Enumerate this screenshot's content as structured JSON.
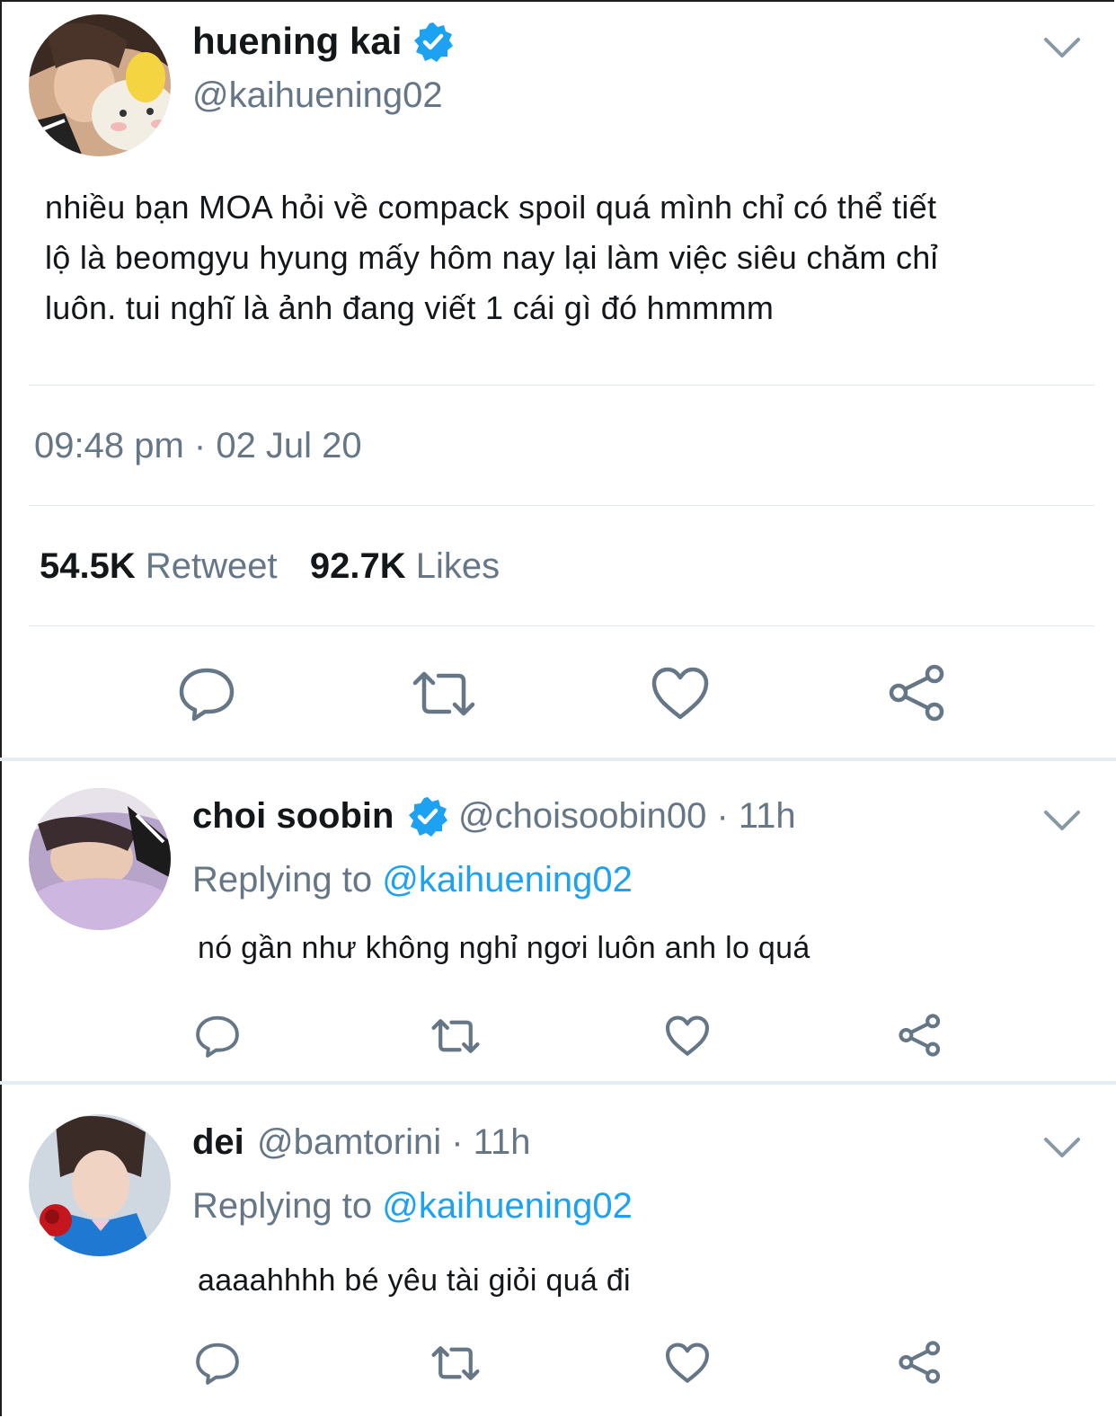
{
  "main_tweet": {
    "display_name": "huening kai",
    "handle": "@kaihuening02",
    "text_lines": [
      "nhiều bạn MOA hỏi về compack spoil quá mình chỉ có thể tiết",
      "lộ là beomgyu hyung mấy hôm nay lại làm việc siêu chăm chỉ",
      "luôn. tui nghĩ là ảnh đang viết 1 cái gì đó hmmmm"
    ],
    "timestamp": "09:48 pm · 02 Jul 20",
    "retweet_count": "54.5K",
    "retweet_label": "Retweet",
    "like_count": "92.7K",
    "like_label": "Likes"
  },
  "replies": [
    {
      "display_name": "choi soobin",
      "handle_time": "@choisoobin00 · 11h",
      "replying_prefix": "Replying to ",
      "replying_handle": "@kaihuening02",
      "text": "nó gần như không nghỉ ngơi luôn anh lo quá"
    },
    {
      "display_name": "dei",
      "handle_time": "@bamtorini · 11h",
      "replying_prefix": "Replying to ",
      "replying_handle": "@kaihuening02",
      "text": "aaaahhhh bé yêu tài giỏi quá đi"
    }
  ],
  "icons": {
    "reply": "reply-icon",
    "retweet": "retweet-icon",
    "like": "heart-icon",
    "share": "share-icon",
    "more": "chevron-down-icon",
    "verified": "verified-badge-icon"
  },
  "colors": {
    "accent": "#1da1f2",
    "secondary_text": "#657786",
    "divider": "#e1e8ed"
  }
}
